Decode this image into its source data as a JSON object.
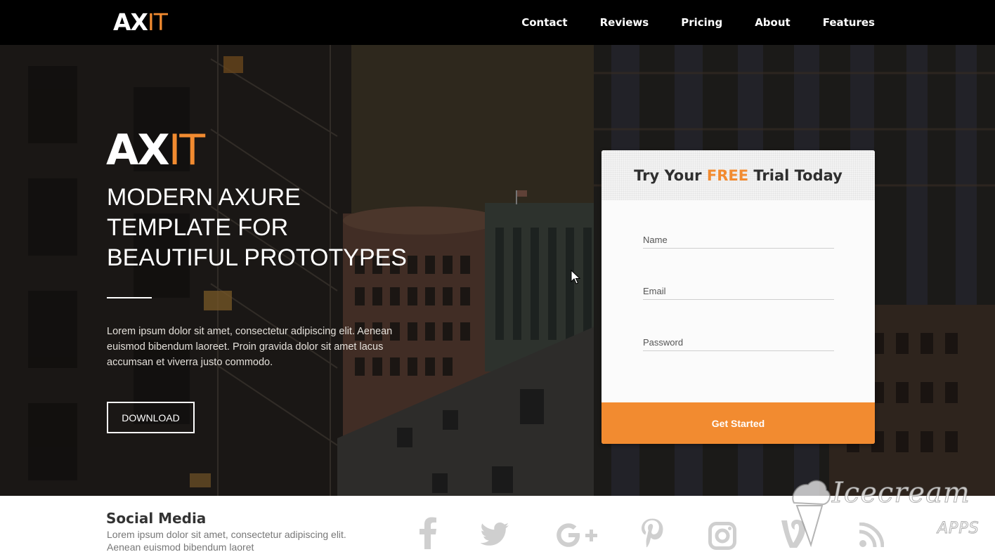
{
  "nav": {
    "logo_ax": "AX",
    "logo_it": "IT",
    "links": [
      "Contact",
      "Reviews",
      "Pricing",
      "About",
      "Features"
    ]
  },
  "hero": {
    "logo_ax": "AX",
    "logo_it": "IT",
    "title_lines": [
      "MODERN AXURE",
      "TEMPLATE FOR",
      "BEAUTIFUL PROTOTYPES"
    ],
    "body": "Lorem ipsum dolor sit amet, consectetur adipiscing elit. Aenean euismod bibendum laoreet. Proin gravida dolor sit amet lacus accumsan et viverra justo commodo.",
    "download_label": "DOWNLOAD"
  },
  "trial": {
    "title_prefix": "Try Your ",
    "title_highlight": "FREE",
    "title_suffix": " Trial Today",
    "name_placeholder": "Name",
    "email_placeholder": "Email",
    "password_placeholder": "Password",
    "cta_label": "Get Started"
  },
  "social": {
    "title": "Social Media",
    "text": "Lorem ipsum dolor sit amet, consectetur adipiscing elit. Aenean euismod bibendum laoret",
    "icons": [
      "facebook-icon",
      "twitter-icon",
      "google-plus-icon",
      "pinterest-icon",
      "instagram-icon",
      "vine-icon",
      "rss-icon"
    ]
  },
  "watermark": {
    "script": "Icecream",
    "apps": "APPS"
  },
  "colors": {
    "accent": "#f28b30",
    "nav_bg": "#000000",
    "card_bg": "#fbfbfb"
  }
}
